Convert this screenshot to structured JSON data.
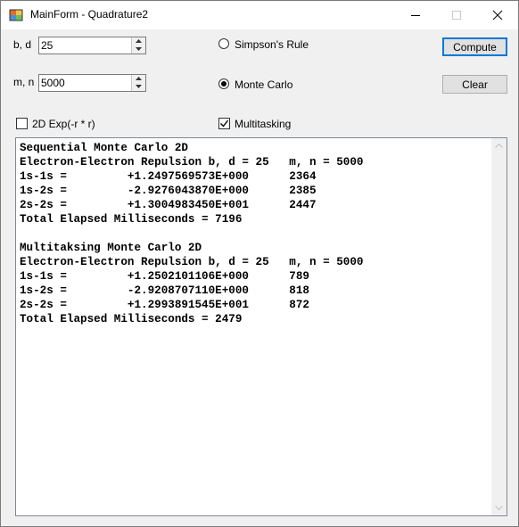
{
  "window": {
    "title": "MainForm - Quadrature2"
  },
  "controls": {
    "bd_label": "b, d",
    "bd_value": "25",
    "mn_label": "m, n",
    "mn_value": "5000",
    "simpson_label": "Simpson's Rule",
    "monte_carlo_label": "Monte Carlo",
    "exp2d_label": "2D Exp(-r * r)",
    "multitasking_label": "Multitasking",
    "monte_carlo_selected": true,
    "simpson_selected": false,
    "exp2d_checked": false,
    "multitasking_checked": true
  },
  "buttons": {
    "compute": "Compute",
    "clear": "Clear"
  },
  "output": {
    "lines": [
      "Sequential Monte Carlo 2D",
      "Electron-Electron Repulsion b, d = 25   m, n = 5000",
      "1s-1s =         +1.2497569573E+000      2364",
      "1s-2s =         -2.9276043870E+000      2385",
      "2s-2s =         +1.3004983450E+001      2447",
      "Total Elapsed Milliseconds = 7196",
      "",
      "Multitaksing Monte Carlo 2D",
      "Electron-Electron Repulsion b, d = 25   m, n = 5000",
      "1s-1s =         +1.2502101106E+000      789",
      "1s-2s =         -2.9208707110E+000      818",
      "2s-2s =         +1.2993891545E+001      872",
      "Total Elapsed Milliseconds = 2479"
    ]
  }
}
